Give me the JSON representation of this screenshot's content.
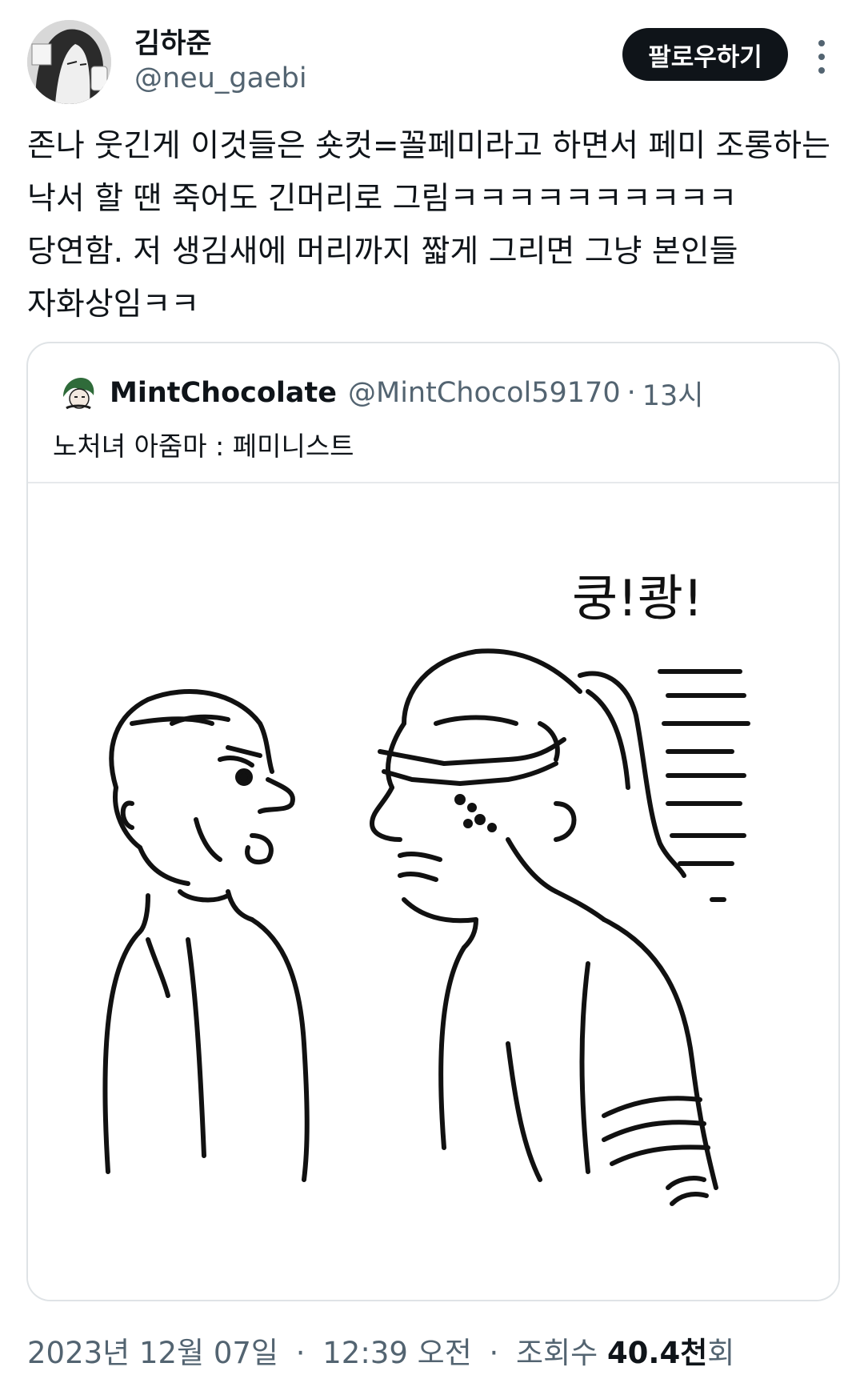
{
  "author": {
    "name": "김하준",
    "handle": "@neu_gaebi"
  },
  "follow_button": "팔로우하기",
  "tweet_lines": [
    "존나 웃긴게 이것들은 숏컷=꼴페미라고 하면서 페미 조롱하는",
    "낙서 할 땐 죽어도 긴머리로 그림ㅋㅋㅋㅋㅋㅋㅋㅋㅋㅋ",
    "당연함. 저 생김새에 머리까지 짧게 그리면 그냥 본인들",
    "자화상임ㅋㅋ"
  ],
  "quote": {
    "name": "MintChocolate",
    "handle": "@MintChocol59170",
    "separator": "·",
    "time": "13시",
    "text": "노처녀 아줌마 : 페미니스트",
    "image_text": "쿵!쾅!"
  },
  "footer": {
    "date": "2023년 12월 07일",
    "separator": "·",
    "time": "12:39 오전",
    "views_label": "조회수",
    "views_value": "40.4천",
    "views_suffix": "회"
  },
  "colors": {
    "text": "#0f1419",
    "muted": "#536471",
    "border": "#dfe3e6",
    "button_bg": "#0f1419"
  }
}
